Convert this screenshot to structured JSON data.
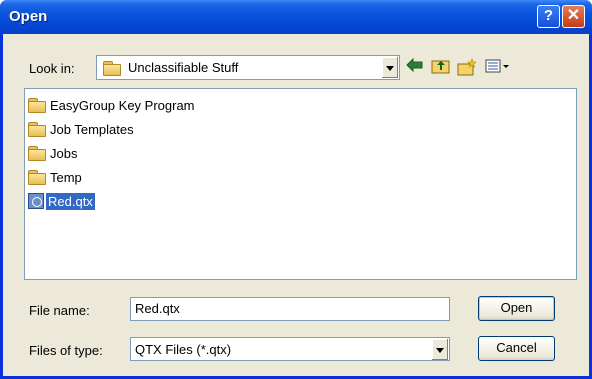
{
  "window": {
    "title": "Open",
    "help_button": "?",
    "close_button": "✕"
  },
  "look_in": {
    "label": "Look in:",
    "value": "Unclassifiable Stuff"
  },
  "toolbar": {
    "icons": [
      "back-arrow-icon",
      "up-folder-icon",
      "new-folder-icon",
      "view-menu-icon"
    ]
  },
  "files": [
    {
      "name": "EasyGroup Key Program",
      "type": "folder"
    },
    {
      "name": "Job Templates",
      "type": "folder"
    },
    {
      "name": "Jobs",
      "type": "folder"
    },
    {
      "name": "Temp",
      "type": "folder"
    },
    {
      "name": "Red.qtx",
      "type": "qtx-file",
      "selected": true
    }
  ],
  "file_name": {
    "label": "File name:",
    "value": "Red.qtx"
  },
  "file_type": {
    "label": "Files of type:",
    "value": "QTX Files (*.qtx)"
  },
  "buttons": {
    "open": "Open",
    "cancel": "Cancel"
  },
  "colors": {
    "title_bar": "#0a54dc",
    "selection": "#316ac5",
    "dialog_bg": "#ece9d8"
  }
}
